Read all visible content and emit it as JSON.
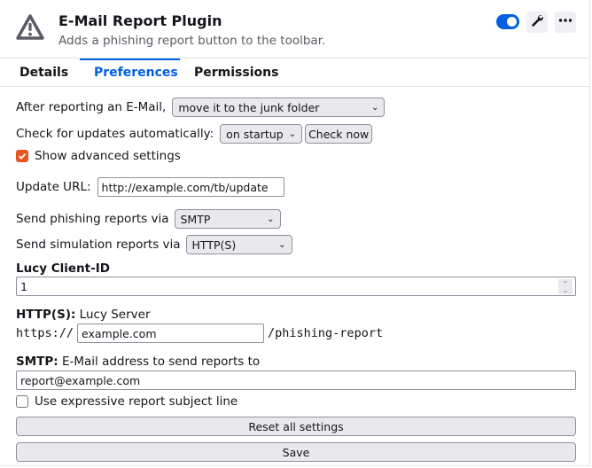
{
  "header": {
    "icon": "warning-triangle-icon",
    "name": "E-Mail Report Plugin",
    "description": "Adds a phishing report button to the toolbar.",
    "enabled": true,
    "wrench_icon": "wrench-icon",
    "more_icon": "more-horizontal-icon"
  },
  "tabs": [
    {
      "label": "Details",
      "active": false
    },
    {
      "label": "Preferences",
      "active": true
    },
    {
      "label": "Permissions",
      "active": false
    }
  ],
  "colors": {
    "accent": "#0061e0",
    "toggle_on": "#0060df",
    "checkbox_checked": "#e95420"
  },
  "prefs": {
    "after_reporting": {
      "label": "After reporting an E-Mail,",
      "value": "move it to the junk folder"
    },
    "check_updates": {
      "label": "Check for updates automatically:",
      "value": "on startup",
      "button": "Check now"
    },
    "show_advanced": {
      "label": "Show advanced settings",
      "checked": true
    },
    "update_url": {
      "label": "Update URL:",
      "value": "http://example.com/tb/update"
    },
    "phishing_via": {
      "label": "Send phishing reports via",
      "value": "SMTP"
    },
    "simulation_via": {
      "label": "Send simulation reports via",
      "value": "HTTP(S)"
    },
    "client_id": {
      "label": "Lucy Client-ID",
      "value": "1"
    },
    "http_server": {
      "label_bold": "HTTP(S):",
      "label_rest": " Lucy Server",
      "prefix": "https://",
      "value": "example.com",
      "suffix": "/phishing-report"
    },
    "smtp": {
      "label_bold": "SMTP:",
      "label_rest": " E-Mail address to send reports to",
      "value": "report@example.com"
    },
    "expressive_subject": {
      "label": "Use expressive report subject line",
      "checked": false
    },
    "reset_button": "Reset all settings",
    "save_button": "Save"
  }
}
